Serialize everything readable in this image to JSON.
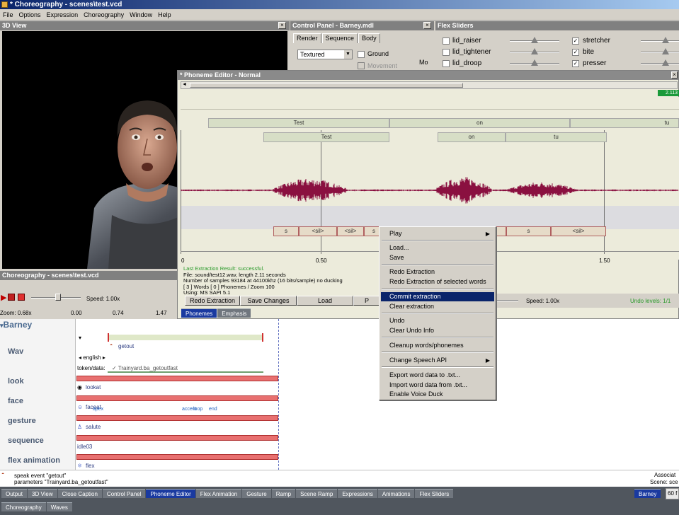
{
  "window": {
    "title": "* Choreography - scenes\\test.vcd"
  },
  "menubar": [
    "File",
    "Options",
    "Expression",
    "Choreography",
    "Window",
    "Help"
  ],
  "view3d": {
    "title": "3D View"
  },
  "control_panel": {
    "title": "Control Panel - Barney.mdl",
    "tabs": [
      "Render",
      "Sequence",
      "Body"
    ],
    "render_mode": "Textured",
    "ground_label": "Ground",
    "movement_label": "Movement",
    "mo_label": "Mo"
  },
  "flex_sliders": {
    "title": "Flex Sliders",
    "left": [
      {
        "label": "lid_raiser",
        "checked": false
      },
      {
        "label": "lid_tightener",
        "checked": false
      },
      {
        "label": "lid_droop",
        "checked": false
      }
    ],
    "right": [
      {
        "label": "stretcher",
        "checked": true
      },
      {
        "label": "bite",
        "checked": true
      },
      {
        "label": "presser",
        "checked": true
      }
    ]
  },
  "phoneme_editor": {
    "title": "* Phoneme Editor - Normal",
    "time_badge": "2.113",
    "words_row1": [
      "Test",
      "on",
      "tu"
    ],
    "words_row2": [
      "Test",
      "on",
      "tu"
    ],
    "phonemes_left": [
      "s",
      "<sil>",
      "<sil>",
      "s"
    ],
    "phonemes_right": [
      "s",
      "<sil>"
    ],
    "ruler": [
      "0",
      "0.50",
      "1.50"
    ],
    "status": {
      "result": "Last Extraction Result:  successful.",
      "file": "File: sound/test12.wav, length 2.11 seconds",
      "samples": "Number of samples 93184 at 44100khz (16 bits/sample) no ducking",
      "words": "[ 3 ] Words [ 0 ] Phonemes / Zoom 100",
      "using": "Using:  MS SAPI 5.1"
    },
    "buttons": [
      "Redo Extraction",
      "Save Changes",
      "Load",
      "P"
    ],
    "tabs": [
      "Phonemes",
      "Emphasis"
    ]
  },
  "context_menu": {
    "items": [
      {
        "label": "Play",
        "submenu": true
      },
      {
        "label": "Load..."
      },
      {
        "label": "Save"
      },
      {
        "label": "Redo Extraction"
      },
      {
        "label": "Redo Extraction of selected words"
      },
      {
        "label": "Commit extraction",
        "highlighted": true
      },
      {
        "label": "Clear extraction"
      },
      {
        "label": "Undo"
      },
      {
        "label": "Clear Undo Info"
      },
      {
        "label": "Cleanup words/phonemes"
      },
      {
        "label": "Change Speech API",
        "submenu": true
      },
      {
        "label": "Export word data to .txt..."
      },
      {
        "label": "Import word data from .txt..."
      },
      {
        "label": "Enable Voice Duck"
      }
    ]
  },
  "choreography": {
    "title": "Choreography - scenes\\test.vcd",
    "speed": "Speed: 1.00x",
    "speed_right": "Speed: 1.00x",
    "undo_levels": "Undo levels: 1/1",
    "zoom": "Zoom: 0.68x",
    "ticks": [
      "0.00",
      "0.74",
      "1.47"
    ],
    "actor": "Barney",
    "tracks": [
      "Wav",
      "look",
      "face",
      "gesture",
      "sequence",
      "flex animation"
    ],
    "events": {
      "getout": "getout",
      "english": "english",
      "token_label": "token/data:",
      "token_value": "Trainyard.ba_getoutfast",
      "lookat": "lookat",
      "faceat": "faceat",
      "apex": "apex",
      "accent": "accent",
      "loop": "loop",
      "end": "end",
      "salute": "salute",
      "idle": "idle03",
      "flex": "flex"
    },
    "status1": "speak event \"getout\"",
    "status2": "parameters \"Trainyard.ba_getoutfast\"",
    "assoc": "Associat",
    "scene": "Scene:  sce"
  },
  "taskbar": {
    "row1": [
      "Output",
      "3D View",
      "Close Caption",
      "Control Panel",
      "Phoneme Editor",
      "Flex Animation",
      "Gesture",
      "Ramp",
      "Scene Ramp",
      "Expressions",
      "Animations",
      "Flex Sliders"
    ],
    "row2": [
      "Choreography",
      "Waves"
    ],
    "active": "Phoneme Editor",
    "actor_button": "Barney",
    "fps": "60 f"
  }
}
